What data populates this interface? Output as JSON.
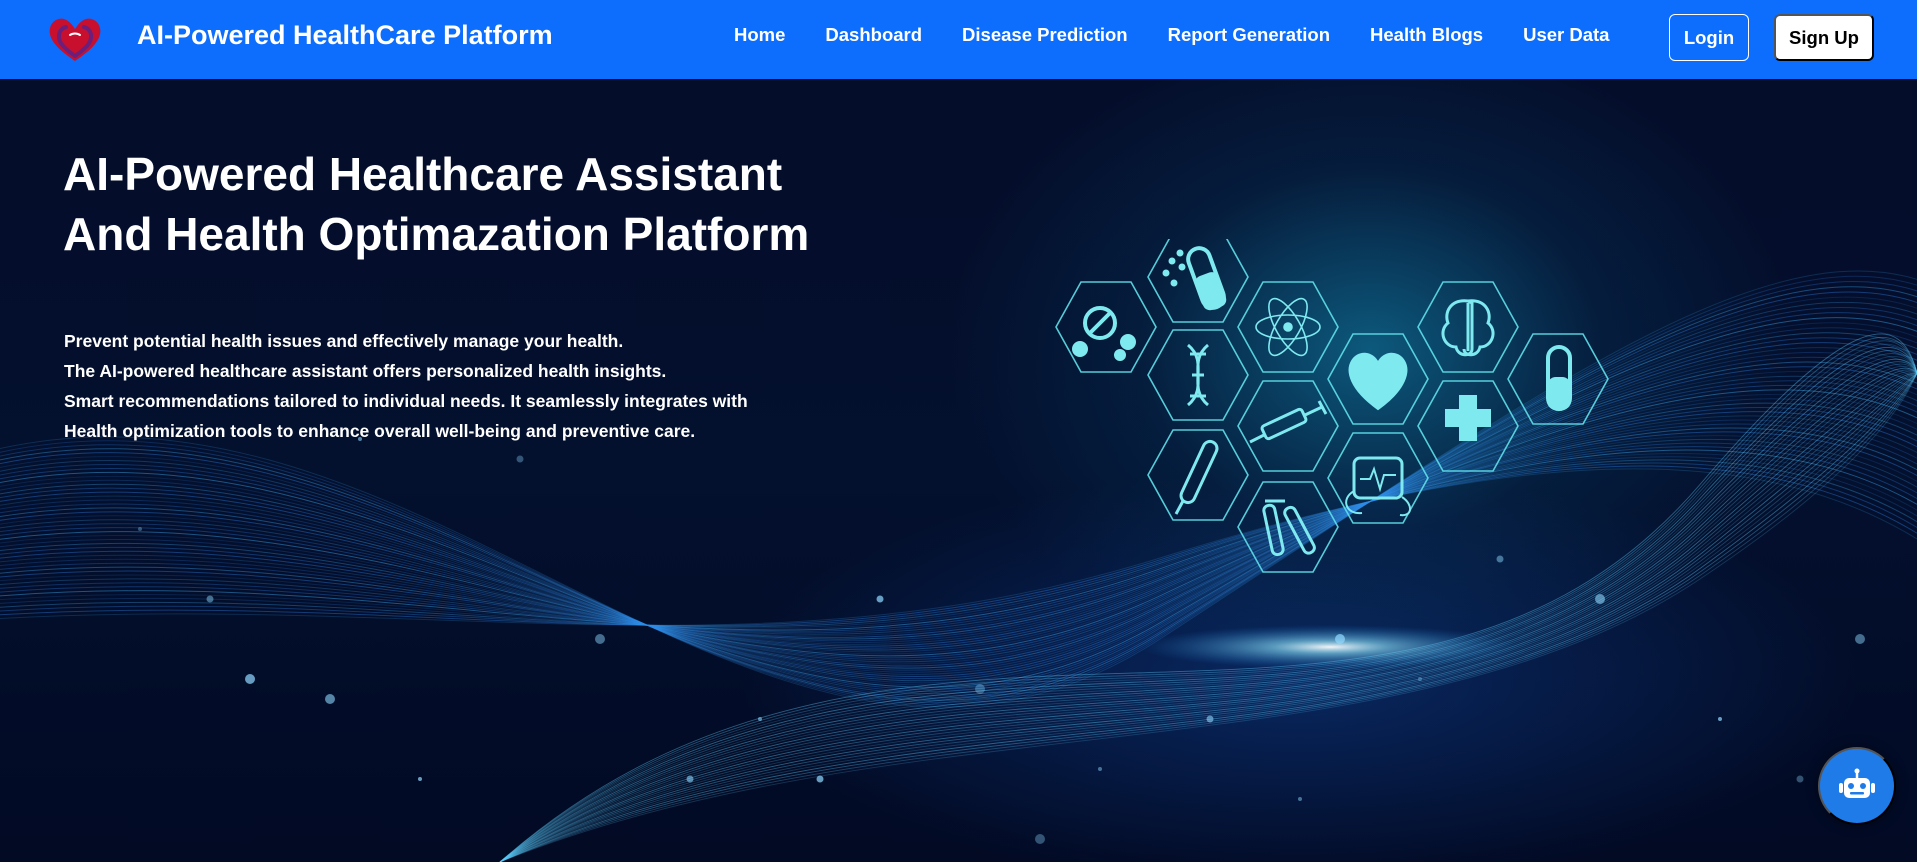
{
  "header": {
    "brand": "AI-Powered HealthCare Platform",
    "logo_icon": "heart-hands-logo",
    "nav": [
      {
        "label": "Home"
      },
      {
        "label": "Dashboard"
      },
      {
        "label": "Disease Prediction"
      },
      {
        "label": "Report Generation"
      },
      {
        "label": "Health Blogs"
      },
      {
        "label": "User Data"
      }
    ],
    "login_label": "Login",
    "signup_label": "Sign Up"
  },
  "hero": {
    "title_lines": [
      "AI-Powered Healthcare Assistant",
      "And Health Optimazation Platform"
    ],
    "description_lines": [
      "Prevent potential health issues and effectively manage your health.",
      "The AI-powered healthcare assistant offers personalized health insights.",
      "Smart recommendations tailored to individual needs. It seamlessly integrates with",
      "Health optimization tools to enhance overall well-being and preventive care."
    ],
    "hex_icons": [
      "pills-icon",
      "capsule-icon",
      "dna-icon",
      "atom-icon",
      "syringe-icon",
      "thermometer-icon",
      "test-tubes-icon",
      "heart-icon",
      "heart-monitor-icon",
      "brain-icon",
      "medical-cross-icon",
      "capsule-vertical-icon"
    ]
  },
  "chat": {
    "icon": "robot-icon"
  },
  "colors": {
    "navbar": "#0d6efd",
    "hero_bg": "#020a24",
    "hex_stroke": "#5fe0ea",
    "chat_button": "#1e7be8"
  }
}
